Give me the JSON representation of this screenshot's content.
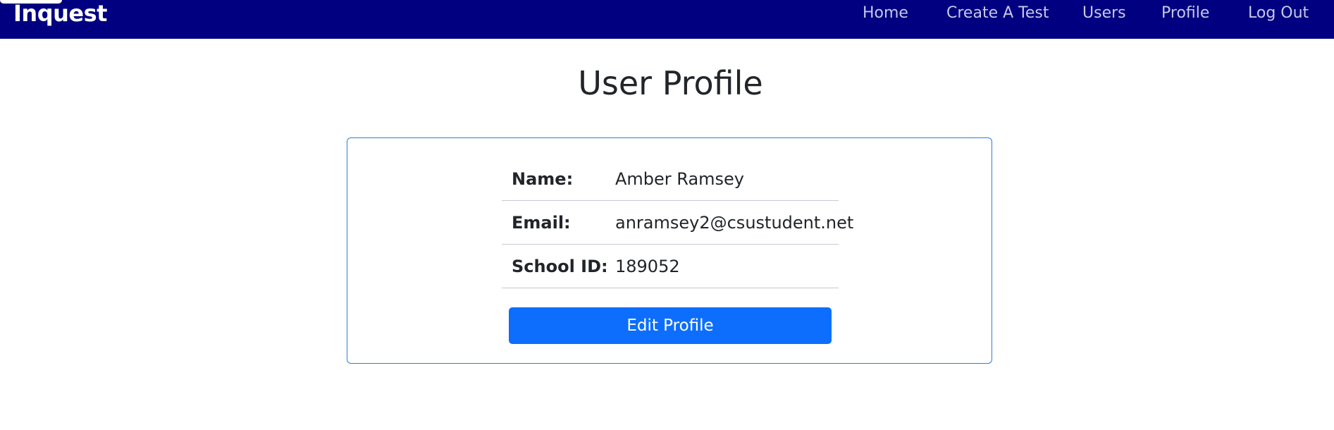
{
  "navbar": {
    "brand": "Inquest",
    "links": [
      {
        "label": "Home"
      },
      {
        "label": "Create A Test"
      },
      {
        "label": "Users"
      },
      {
        "label": "Profile"
      },
      {
        "label": "Log Out"
      }
    ],
    "background_color": "#000080",
    "link_color": "#c6c8e8"
  },
  "main": {
    "title": "User Profile",
    "profile": {
      "rows": [
        {
          "label": "Name:",
          "value": "Amber Ramsey"
        },
        {
          "label": "Email:",
          "value": "anramsey2@csustudent.net"
        },
        {
          "label": "School ID:",
          "value": "189052"
        }
      ]
    },
    "edit_button_label": "Edit Profile",
    "accent_color": "#0d6efd",
    "card_border_color": "#2f7fd4"
  }
}
